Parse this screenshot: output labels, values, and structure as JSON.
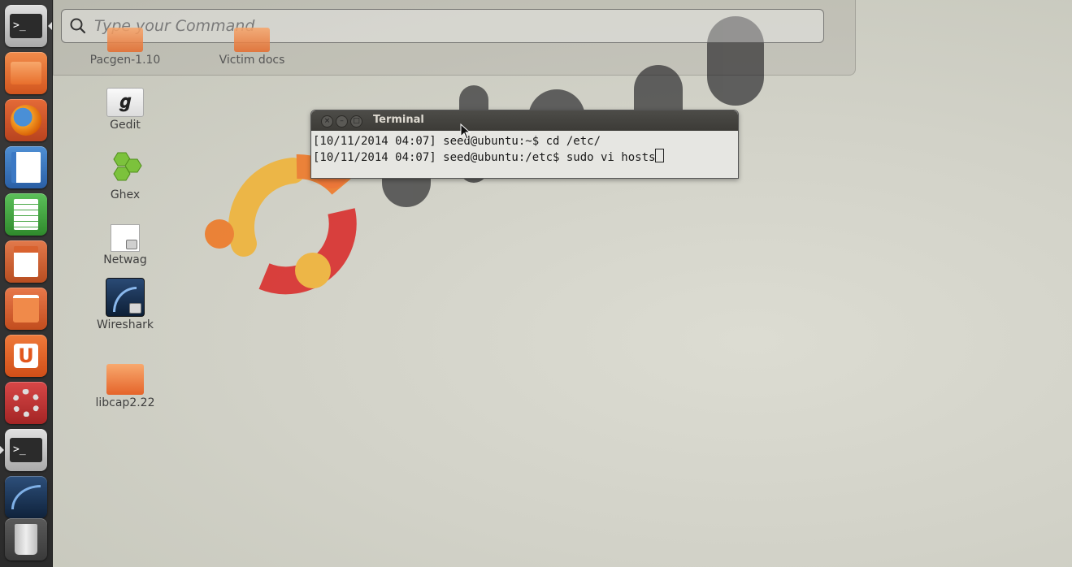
{
  "dash": {
    "search_placeholder": "Type your Command"
  },
  "launcher": {
    "items": [
      {
        "name": "terminal-launcher",
        "icon": "terminal-icon"
      },
      {
        "name": "files-launcher",
        "icon": "folder-icon"
      },
      {
        "name": "firefox-launcher",
        "icon": "firefox-icon"
      },
      {
        "name": "writer-launcher",
        "icon": "writer-icon"
      },
      {
        "name": "calc-launcher",
        "icon": "calc-icon"
      },
      {
        "name": "impress-launcher",
        "icon": "impress-icon"
      },
      {
        "name": "software-center-launcher",
        "icon": "shopping-bag-icon"
      },
      {
        "name": "ubuntu-one-launcher",
        "icon": "ubuntu-one-icon"
      },
      {
        "name": "system-settings-launcher",
        "icon": "settings-icon"
      },
      {
        "name": "terminal-running-launcher",
        "icon": "terminal-icon"
      },
      {
        "name": "wireshark-launcher",
        "icon": "wireshark-icon"
      },
      {
        "name": "trash-launcher",
        "icon": "trash-icon"
      }
    ]
  },
  "desktop": {
    "icons": [
      {
        "label": "Pacgen-1.10"
      },
      {
        "label": "Victim docs"
      },
      {
        "label": "Gedit"
      },
      {
        "label": "Ghex"
      },
      {
        "label": "Netwag"
      },
      {
        "label": "Wireshark"
      },
      {
        "label": "libcap2.22"
      }
    ]
  },
  "terminal": {
    "title": "Terminal",
    "lines": [
      "[10/11/2014 04:07] seed@ubuntu:~$ cd /etc/",
      "[10/11/2014 04:07] seed@ubuntu:/etc$ sudo vi hosts"
    ]
  },
  "colors": {
    "launcher_bg": "#2f2f2f",
    "accent_orange": "#e95420",
    "terminal_title": "#3c3b37"
  }
}
